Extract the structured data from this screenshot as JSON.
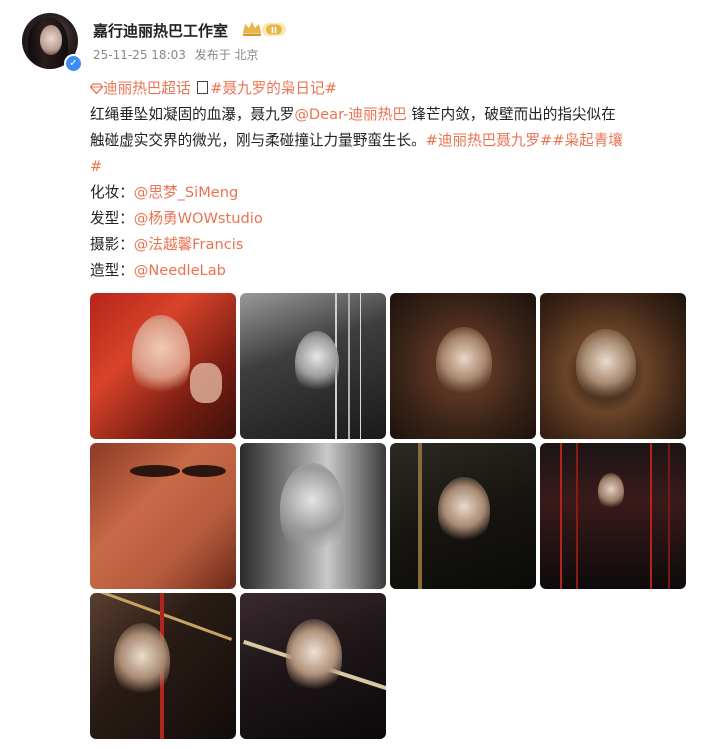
{
  "user": {
    "name": "嘉行迪丽热巴工作室",
    "vip_level": "II",
    "timestamp": "25-11-25 18:03",
    "location": "发布于 北京"
  },
  "post": {
    "supertopic": "迪丽热巴超话",
    "topic1": "#聂九罗的枭日记#",
    "text_a": "红绳垂坠如凝固的血瀑，聂九罗",
    "mention_main": "@Dear-迪丽热巴",
    "text_b": " 锋芒内敛，破壁而出的指尖似在",
    "text_c": "触碰虚实交界的微光，刚与柔碰撞让力量野蛮生长。",
    "topic2": "#迪丽热巴聂九罗#",
    "topic3": "#枭起青壤",
    "topic3_tail": "#",
    "credits": [
      {
        "label": "化妆：",
        "mention": "@思梦_SiMeng"
      },
      {
        "label": "发型：",
        "mention": "@杨勇WOWstudio"
      },
      {
        "label": "摄影：",
        "mention": "@法越馨Francis"
      },
      {
        "label": "造型：",
        "mention": "@NeedleLab"
      }
    ]
  },
  "colors": {
    "link": "#eb7350",
    "verify": "#3b8cf5",
    "vip_gold": "#e8b54a"
  },
  "images": {
    "count": 10
  }
}
